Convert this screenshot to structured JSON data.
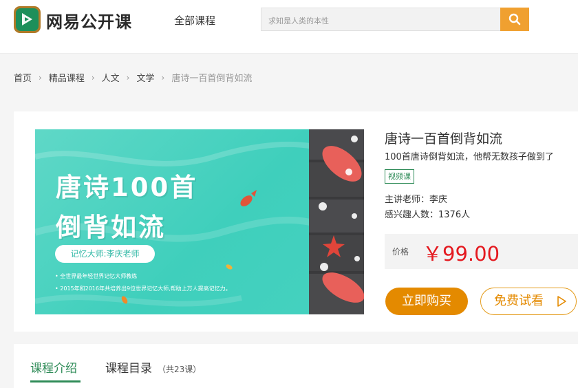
{
  "header": {
    "brand": "网易公开课",
    "nav_all": "全部课程",
    "search_placeholder": "求知是人类的本性"
  },
  "breadcrumb": [
    "首页",
    "精品课程",
    "人文",
    "文学",
    "唐诗一百首倒背如流"
  ],
  "course": {
    "banner": {
      "title_line1": "唐诗100首",
      "title_line2": "倒背如流",
      "pill": "记忆大师:李庆老师",
      "bullet1": "• 全世界最年轻世界记忆大师教练",
      "bullet2": "• 2015年和2016年共培养出9位世界记忆大师,帮助上万人提高记忆力。"
    },
    "title": "唐诗一百首倒背如流",
    "subtitle": "100首唐诗倒背如流，他帮无数孩子做到了",
    "tag": "视频课",
    "teacher": "主讲老师：李庆",
    "interest": "感兴趣人数：1376人",
    "price_label": "价格",
    "price": "￥99.00",
    "buy_label": "立即购买",
    "trial_label": "免费试看"
  },
  "tabs": {
    "intro": "课程介绍",
    "catalog": "课程目录",
    "catalog_count": "（共23课）"
  },
  "colors": {
    "brand_green": "#2e8b57",
    "accent_orange": "#e48a00",
    "price_red": "#e4191f",
    "search_orange": "#f0a030"
  },
  "icons": [
    "play-logo-icon",
    "search-icon",
    "chevron-right-icon",
    "play-triangle-icon"
  ]
}
